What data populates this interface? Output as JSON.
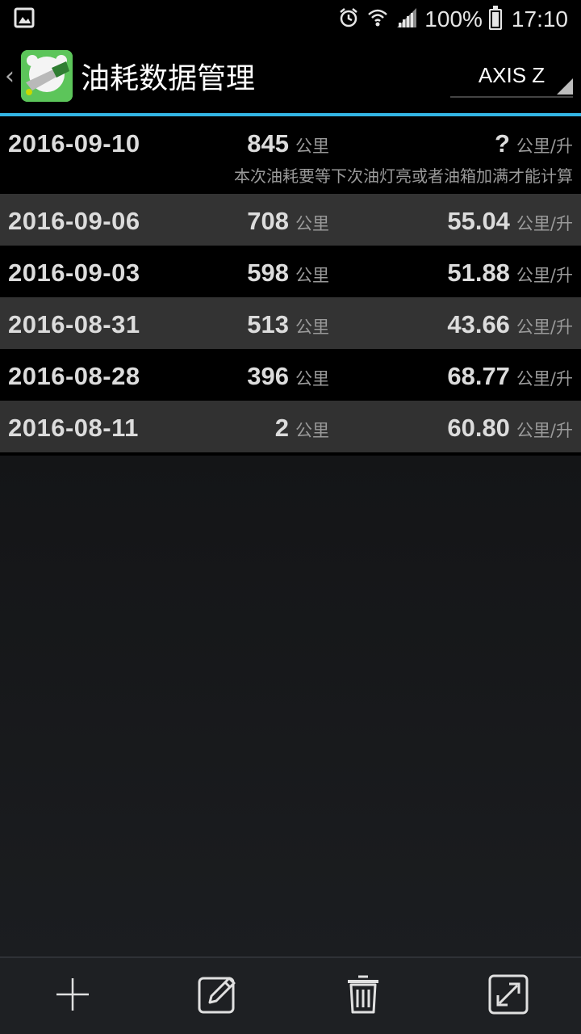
{
  "status_bar": {
    "battery": "100%",
    "time": "17:10",
    "icons": [
      "gallery-icon",
      "alarm-icon",
      "wifi-icon",
      "signal-icon",
      "battery-icon"
    ]
  },
  "app_bar": {
    "title": "油耗数据管理",
    "vehicle_selector": "AXIS Z",
    "accent_color": "#33b5e5"
  },
  "records": [
    {
      "date": "2016-09-10",
      "distance": "845",
      "distance_unit": "公里",
      "efficiency": "?",
      "efficiency_unit": "公里/升",
      "note": "本次油耗要等下次油灯亮或者油箱加满才能计算"
    },
    {
      "date": "2016-09-06",
      "distance": "708",
      "distance_unit": "公里",
      "efficiency": "55.04",
      "efficiency_unit": "公里/升"
    },
    {
      "date": "2016-09-03",
      "distance": "598",
      "distance_unit": "公里",
      "efficiency": "51.88",
      "efficiency_unit": "公里/升"
    },
    {
      "date": "2016-08-31",
      "distance": "513",
      "distance_unit": "公里",
      "efficiency": "43.66",
      "efficiency_unit": "公里/升"
    },
    {
      "date": "2016-08-28",
      "distance": "396",
      "distance_unit": "公里",
      "efficiency": "68.77",
      "efficiency_unit": "公里/升"
    },
    {
      "date": "2016-08-11",
      "distance": "2",
      "distance_unit": "公里",
      "efficiency": "60.80",
      "efficiency_unit": "公里/升"
    }
  ],
  "bottom_toolbar": {
    "icons": [
      "add-icon",
      "edit-icon",
      "delete-icon",
      "expand-icon"
    ]
  }
}
